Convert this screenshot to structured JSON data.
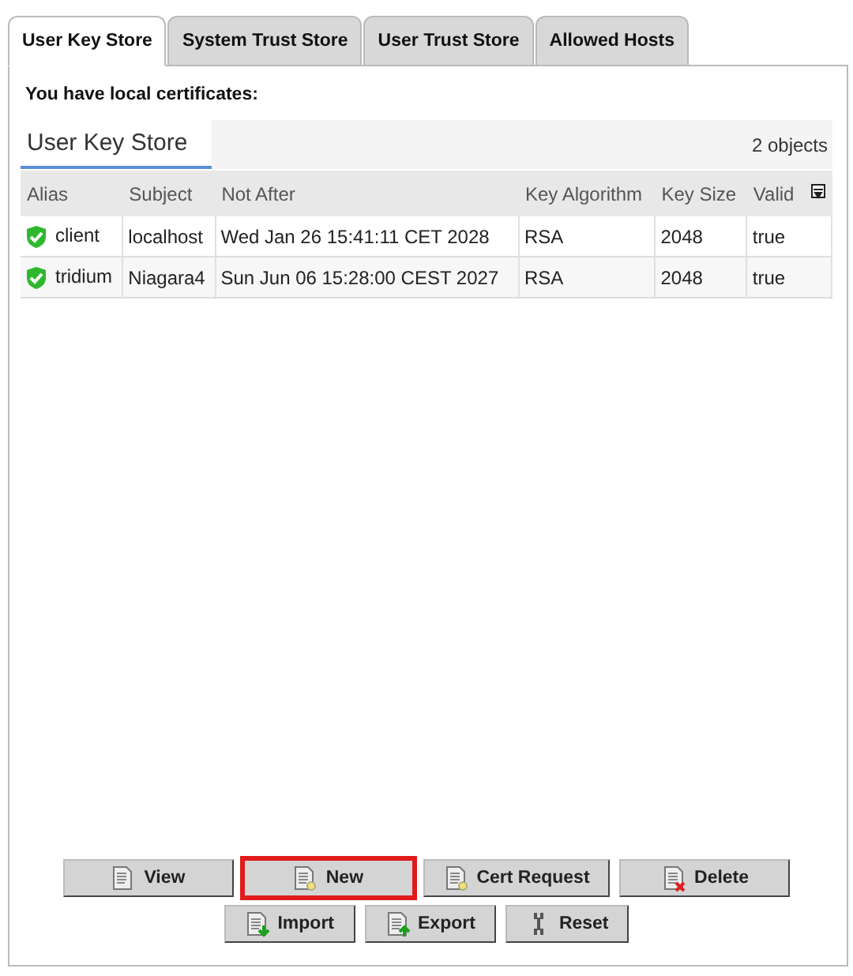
{
  "tabs": [
    {
      "label": "User Key Store",
      "selected": true
    },
    {
      "label": "System Trust Store",
      "selected": false
    },
    {
      "label": "User Trust Store",
      "selected": false
    },
    {
      "label": "Allowed Hosts",
      "selected": false
    }
  ],
  "heading": "You have local certificates:",
  "table": {
    "title": "User Key Store",
    "count": "2 objects",
    "columns": [
      "Alias",
      "Subject",
      "Not After",
      "Key Algorithm",
      "Key Size",
      "Valid"
    ],
    "rows": [
      {
        "cells": [
          "client",
          "localhost",
          "Wed Jan 26 15:41:11 CET 2028",
          "RSA",
          "2048",
          "true"
        ]
      },
      {
        "cells": [
          "tridium",
          "Niagara4",
          "Sun Jun 06 15:28:00 CEST 2027",
          "RSA",
          "2048",
          "true"
        ]
      }
    ]
  },
  "button_rows": [
    [
      {
        "label": "View",
        "kind": "view",
        "highlighted": false
      },
      {
        "label": "New",
        "kind": "new",
        "highlighted": true
      },
      {
        "label": "Cert Request",
        "kind": "new",
        "highlighted": false
      },
      {
        "label": "Delete",
        "kind": "delete",
        "highlighted": false
      }
    ],
    [
      {
        "label": "Import",
        "kind": "import",
        "highlighted": false
      },
      {
        "label": "Export",
        "kind": "export",
        "highlighted": false
      },
      {
        "label": "Reset",
        "kind": "reset",
        "highlighted": false
      }
    ]
  ]
}
